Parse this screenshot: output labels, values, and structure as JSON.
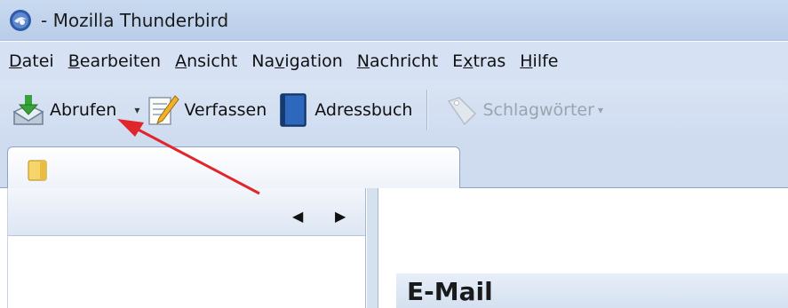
{
  "window": {
    "title": "- Mozilla Thunderbird",
    "app_icon": "thunderbird-icon"
  },
  "menu": {
    "items": [
      {
        "acc": "D",
        "rest": "atei"
      },
      {
        "acc": "B",
        "rest": "earbeiten"
      },
      {
        "acc": "A",
        "rest": "nsicht"
      },
      {
        "pre": "Na",
        "acc": "v",
        "rest": "igation"
      },
      {
        "acc": "N",
        "rest": "achricht"
      },
      {
        "pre": "E",
        "acc": "x",
        "rest": "tras"
      },
      {
        "acc": "H",
        "rest": "ilfe"
      }
    ]
  },
  "toolbar": {
    "get_mail": {
      "label": "Abrufen",
      "icon": "get-mail-icon"
    },
    "compose": {
      "label": "Verfassen",
      "icon": "compose-icon"
    },
    "address_book": {
      "label": "Adressbuch",
      "icon": "address-book-icon"
    },
    "tags": {
      "label": "Schlagwörter",
      "icon": "tag-icon",
      "enabled": false
    }
  },
  "tabs": [
    {
      "icon": "folder-icon",
      "label": ""
    }
  ],
  "folder_pane": {
    "prev_icon": "triangle-left-icon",
    "next_icon": "triangle-right-icon"
  },
  "content": {
    "section_title": "E-Mail"
  },
  "annotation": {
    "type": "red-arrow",
    "color": "#e0262b"
  },
  "colors": {
    "titlebar": "#c9daf0",
    "menubar": "#d6e2f3",
    "toolbar": "#d3dff1",
    "accent_red": "#e0262b"
  }
}
